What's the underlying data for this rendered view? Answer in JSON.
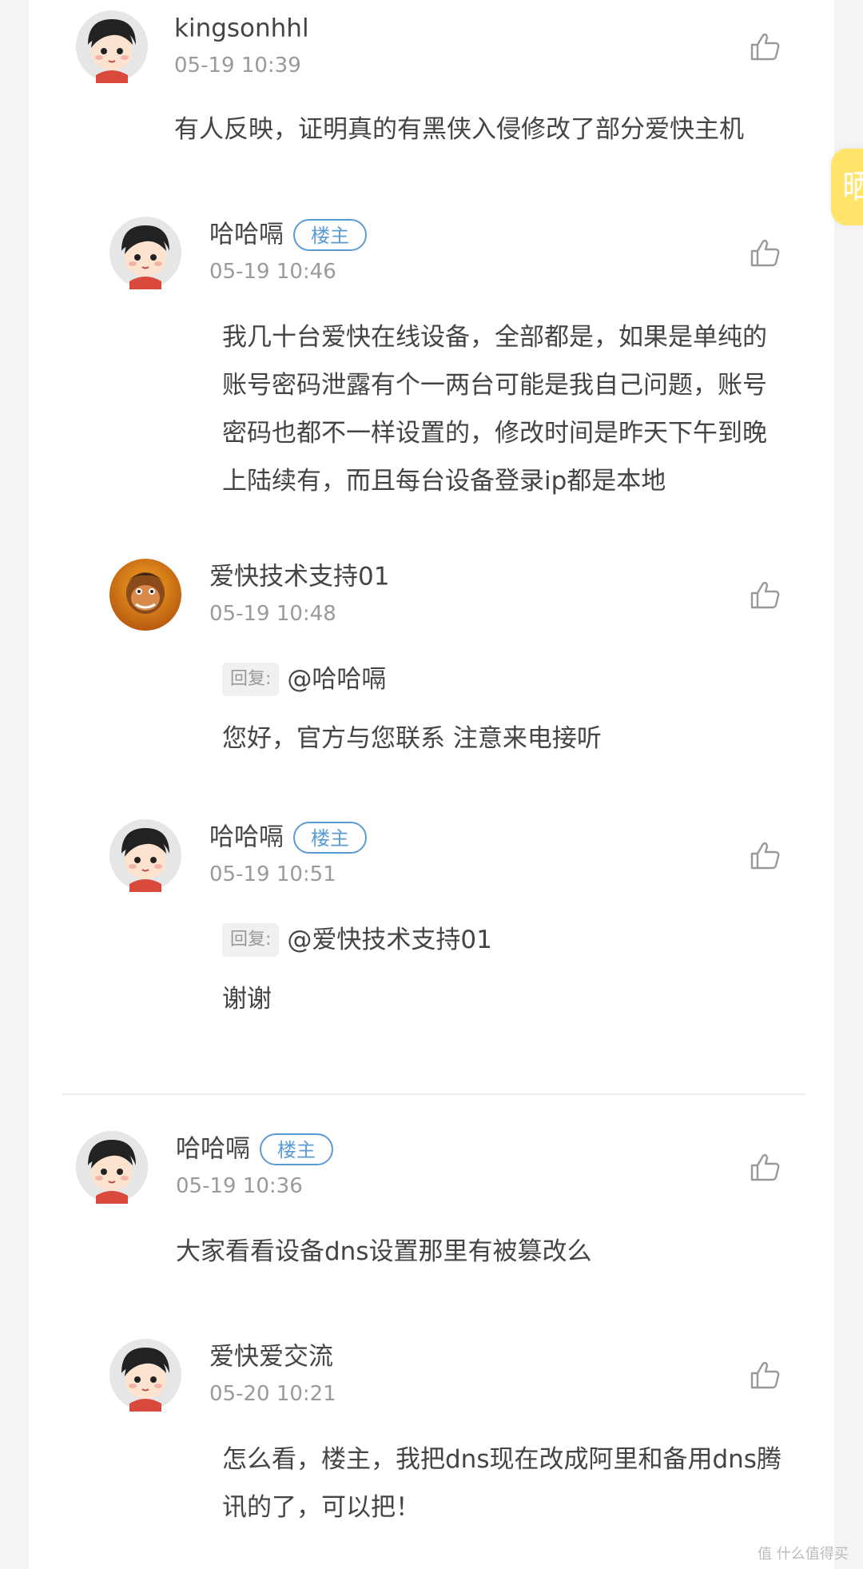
{
  "side_tab": {
    "label": "晒"
  },
  "comments": [
    {
      "user": "kingsonhhl",
      "badge": "",
      "time": "05-19  10:39",
      "reply_label": "",
      "reply_to": "",
      "text": "有人反映，证明真的有黑侠入侵修改了部分爱快主机"
    },
    {
      "user": "哈哈嗝",
      "badge": "楼主",
      "time": "05-19  10:46",
      "reply_label": "",
      "reply_to": "",
      "text": "我几十台爱快在线设备，全部都是，如果是单纯的账号密码泄露有个一两台可能是我自己问题，账号密码也都不一样设置的，修改时间是昨天下午到晚上陆续有，而且每台设备登录ip都是本地"
    },
    {
      "user": "爱快技术支持01",
      "badge": "",
      "time": "05-19  10:48",
      "reply_label": "回复:",
      "reply_to": "@哈哈嗝",
      "text": "您好，官方与您联系  注意来电接听"
    },
    {
      "user": "哈哈嗝",
      "badge": "楼主",
      "time": "05-19  10:51",
      "reply_label": "回复:",
      "reply_to": "@爱快技术支持01",
      "text": "谢谢"
    },
    {
      "user": "哈哈嗝",
      "badge": "楼主",
      "time": "05-19  10:36",
      "reply_label": "",
      "reply_to": "",
      "text": "大家看看设备dns设置那里有被篡改么"
    },
    {
      "user": "爱快爱交流",
      "badge": "",
      "time": "05-20  10:21",
      "reply_label": "",
      "reply_to": "",
      "text": "怎么看，楼主，我把dns现在改成阿里和备用dns腾讯的了，可以把！"
    }
  ],
  "watermark": "值 什么值得买",
  "colors": {
    "badge": "#5b9bd5",
    "side_tab": "#ffe469",
    "time": "#9a9a9a"
  }
}
